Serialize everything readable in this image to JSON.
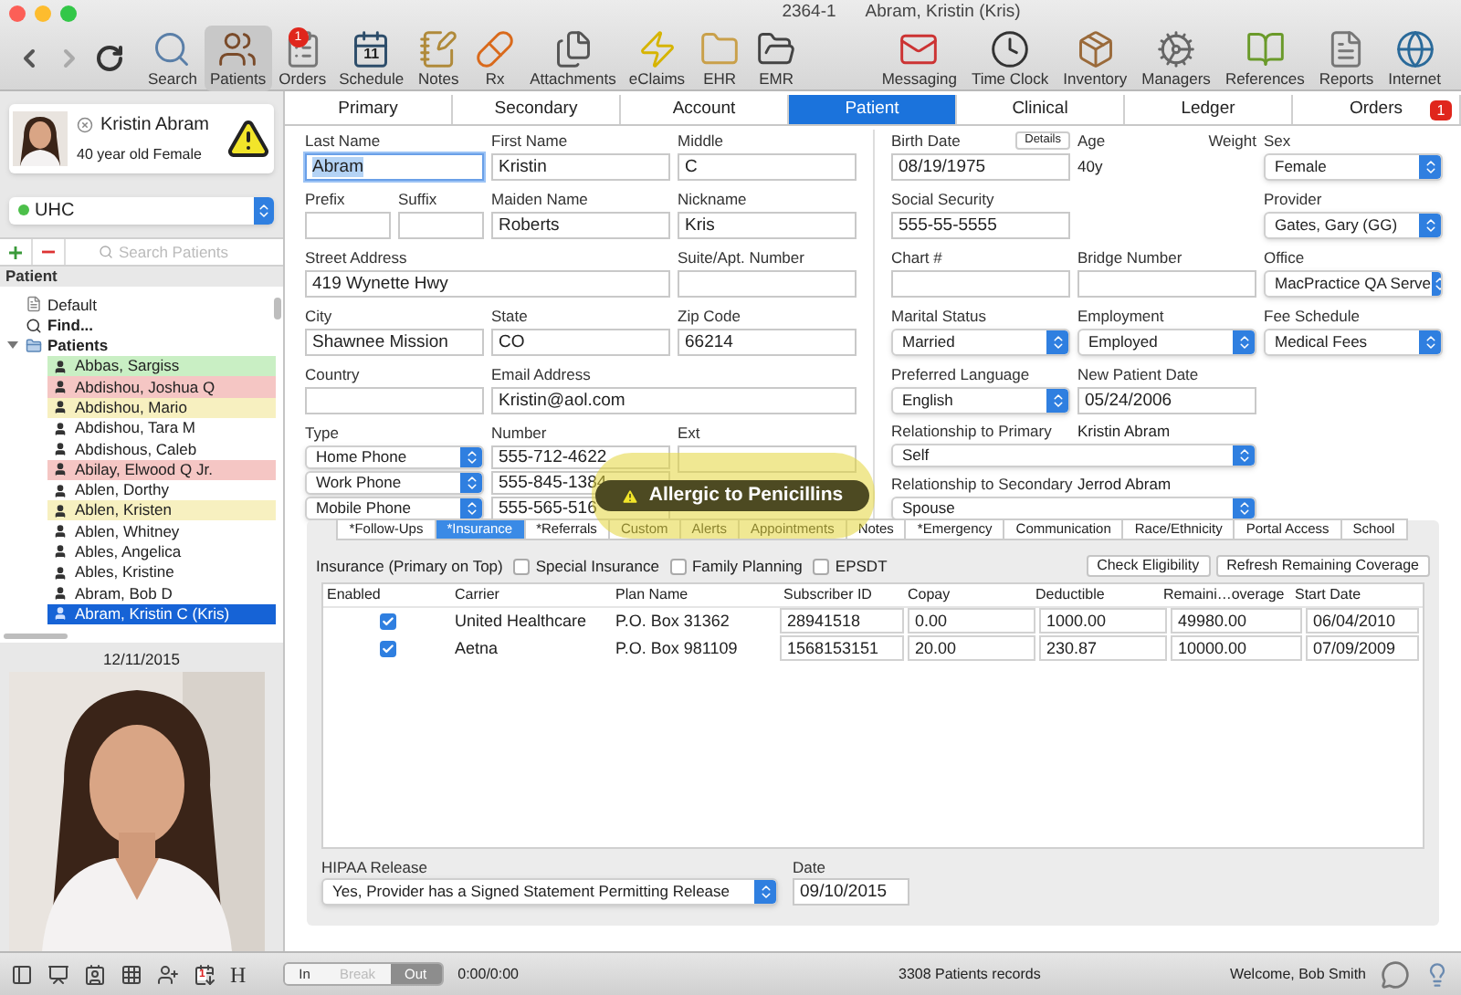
{
  "window": {
    "record": "2364-1",
    "title": "Abram, Kristin (Kris)"
  },
  "toolbar": {
    "left": [
      {
        "label": "Search",
        "selected": false
      },
      {
        "label": "Patients",
        "selected": true
      },
      {
        "label": "Orders",
        "selected": false,
        "badge": "1"
      },
      {
        "label": "Schedule",
        "selected": false,
        "icon_text": "11"
      },
      {
        "label": "Notes",
        "selected": false
      },
      {
        "label": "Rx",
        "selected": false
      },
      {
        "label": "Attachments",
        "selected": false
      },
      {
        "label": "eClaims",
        "selected": false
      },
      {
        "label": "EHR",
        "selected": false
      },
      {
        "label": "EMR",
        "selected": false
      }
    ],
    "right": [
      {
        "label": "Messaging",
        "selected": false
      },
      {
        "label": "Time Clock",
        "selected": false
      },
      {
        "label": "Inventory",
        "selected": false
      },
      {
        "label": "Managers",
        "selected": false
      },
      {
        "label": "References",
        "selected": false
      },
      {
        "label": "Reports",
        "selected": false
      },
      {
        "label": "Internet",
        "selected": false
      }
    ]
  },
  "patient_card": {
    "name": "Kristin Abram",
    "summary": "40 year old Female"
  },
  "insurance_picker": {
    "value": "UHC"
  },
  "patient_search": {
    "placeholder": "Search Patients"
  },
  "list_header": "Patient",
  "tree": [
    {
      "label": "Default",
      "kind": "document",
      "selected": false
    },
    {
      "label": "Find...",
      "kind": "search",
      "selected": false
    },
    {
      "label": "Patients",
      "kind": "folder",
      "selected": false,
      "expanded": true,
      "children": [
        {
          "label": "Abbas, Sargiss",
          "color": "#c9efc4",
          "selected": false
        },
        {
          "label": "Abdishou, Joshua Q",
          "color": "#f5c6c4",
          "selected": false
        },
        {
          "label": "Abdishou, Mario",
          "color": "#f7f0c0",
          "selected": false
        },
        {
          "label": "Abdishou, Tara M",
          "selected": false
        },
        {
          "label": "Abdishous, Caleb",
          "selected": false
        },
        {
          "label": "Abilay, Elwood Q Jr.",
          "color": "#f5c6c4",
          "selected": false
        },
        {
          "label": "Ablen, Dorthy",
          "selected": false
        },
        {
          "label": "Ablen, Kristen",
          "color": "#f7f0c0",
          "selected": false
        },
        {
          "label": "Ablen, Whitney",
          "selected": false
        },
        {
          "label": "Ables, Angelica",
          "selected": false
        },
        {
          "label": "Ables, Kristine",
          "selected": false
        },
        {
          "label": "Abram, Bob D",
          "selected": false
        },
        {
          "label": "Abram, Kristin C (Kris)",
          "selected": true
        }
      ]
    }
  ],
  "photo_date": "12/11/2015",
  "tabs": [
    {
      "label": "Primary",
      "selected": false
    },
    {
      "label": "Secondary",
      "selected": false
    },
    {
      "label": "Account",
      "selected": false
    },
    {
      "label": "Patient",
      "selected": true
    },
    {
      "label": "Clinical",
      "selected": false
    },
    {
      "label": "Ledger",
      "selected": false
    },
    {
      "label": "Orders",
      "selected": false,
      "badge": "1"
    }
  ],
  "form": {
    "last_name": {
      "label": "Last Name",
      "value": "Abram"
    },
    "first_name": {
      "label": "First Name",
      "value": "Kristin"
    },
    "middle": {
      "label": "Middle",
      "value": "C"
    },
    "prefix": {
      "label": "Prefix"
    },
    "suffix": {
      "label": "Suffix"
    },
    "maiden_name": {
      "label": "Maiden Name",
      "value": "Roberts"
    },
    "nickname": {
      "label": "Nickname",
      "value": "Kris"
    },
    "street_address": {
      "label": "Street Address",
      "value": "419 Wynette Hwy"
    },
    "suite": {
      "label": "Suite/Apt. Number"
    },
    "city": {
      "label": "City",
      "value": "Shawnee Mission"
    },
    "state": {
      "label": "State",
      "value": "CO"
    },
    "zip_code": {
      "label": "Zip Code",
      "value": "66214"
    },
    "country": {
      "label": "Country"
    },
    "email": {
      "label": "Email Address",
      "value": "Kristin@aol.com"
    },
    "phones": {
      "type_label": "Type",
      "number_label": "Number",
      "ext_label": "Ext",
      "rows": [
        {
          "type": "Home Phone",
          "number": "555-712-4622"
        },
        {
          "type": "Work Phone",
          "number": "555-845-1384"
        },
        {
          "type": "Mobile Phone",
          "number": "555-565-516"
        }
      ]
    },
    "birth_date": {
      "label": "Birth Date",
      "value": "08/19/1975",
      "button": "Details"
    },
    "age": {
      "label": "Age",
      "value": "40y"
    },
    "weight": {
      "label": "Weight"
    },
    "sex": {
      "label": "Sex",
      "value": "Female"
    },
    "social_security": {
      "label": "Social Security",
      "value": "555-55-5555"
    },
    "provider": {
      "label": "Provider",
      "value": "Gates, Gary (GG)"
    },
    "chart_number": {
      "label": "Chart #"
    },
    "bridge_number": {
      "label": "Bridge Number"
    },
    "office": {
      "label": "Office",
      "value": "MacPractice QA Serve"
    },
    "marital_status": {
      "label": "Marital Status",
      "value": "Married"
    },
    "employment": {
      "label": "Employment",
      "value": "Employed"
    },
    "fee_schedule": {
      "label": "Fee Schedule",
      "value": "Medical Fees"
    },
    "preferred_language": {
      "label": "Preferred Language",
      "value": "English"
    },
    "new_patient_date": {
      "label": "New Patient Date",
      "value": "05/24/2006"
    },
    "relationship_primary": {
      "label": "Relationship to Primary",
      "name": "Kristin Abram",
      "value": "Self"
    },
    "relationship_secondary": {
      "label": "Relationship to Secondary",
      "name": "Jerrod Abram",
      "value": "Spouse"
    }
  },
  "alert": {
    "text": "Allergic to Penicillins"
  },
  "subtabs": [
    {
      "label": "*Follow-Ups",
      "selected": false
    },
    {
      "label": "*Insurance",
      "selected": true
    },
    {
      "label": "*Referrals",
      "selected": false
    },
    {
      "label": "Custom",
      "selected": false
    },
    {
      "label": "Alerts",
      "selected": false
    },
    {
      "label": "Appointments",
      "selected": false
    },
    {
      "label": "Notes",
      "selected": false
    },
    {
      "label": "*Emergency",
      "selected": false
    },
    {
      "label": "Communication",
      "selected": false
    },
    {
      "label": "Race/Ethnicity",
      "selected": false
    },
    {
      "label": "Portal Access",
      "selected": false
    },
    {
      "label": "School",
      "selected": false
    }
  ],
  "insurance": {
    "title": "Insurance (Primary on Top)",
    "options": [
      {
        "label": "Special Insurance",
        "checked": false
      },
      {
        "label": "Family Planning",
        "checked": false
      },
      {
        "label": "EPSDT",
        "checked": false
      }
    ],
    "buttons": [
      "Check Eligibility",
      "Refresh Remaining Coverage"
    ],
    "columns": [
      "Enabled",
      "Carrier",
      "Plan Name",
      "Subscriber ID",
      "Copay",
      "Deductible",
      "Remaini…overage",
      "Start Date"
    ],
    "rows": [
      {
        "enabled": true,
        "carrier": "United Healthcare",
        "plan_name": "P.O. Box 31362",
        "subscriber_id": "28941518",
        "copay": "0.00",
        "deductible": "1000.00",
        "remaining": "49980.00",
        "start_date": "06/04/2010"
      },
      {
        "enabled": true,
        "carrier": "Aetna",
        "plan_name": "P.O. Box 981109",
        "subscriber_id": "1568153151",
        "copay": "20.00",
        "deductible": "230.87",
        "remaining": "10000.00",
        "start_date": "07/09/2009"
      }
    ]
  },
  "hipaa": {
    "label": "HIPAA Release",
    "value": "Yes, Provider has a Signed Statement Permitting Release",
    "date_label": "Date",
    "date": "09/10/2015"
  },
  "status_bar": {
    "calendar_badge": "1",
    "letter": "H",
    "clock_segments": [
      {
        "label": "In",
        "selected": false,
        "disabled": false
      },
      {
        "label": "Break",
        "selected": false,
        "disabled": true
      },
      {
        "label": "Out",
        "selected": true,
        "disabled": false
      }
    ],
    "time": "0:00/0:00",
    "records": "3308 Patients records",
    "welcome": "Welcome, Bob Smith"
  }
}
